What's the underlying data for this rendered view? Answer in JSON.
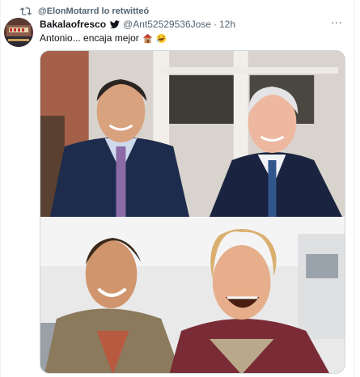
{
  "retweet": {
    "text": "@ElonMotarrd lo retwitteó"
  },
  "tweet": {
    "name": "Bakalaofresco",
    "handle": "@Ant52529536Jose",
    "separator": "·",
    "time": "12h",
    "more_label": "···",
    "text": "Antonio... encaja mejor",
    "emojis": [
      "house-emoji",
      "rofl-emoji"
    ]
  },
  "media": {
    "images": [
      "photo-politicians",
      "photo-movie-scene"
    ]
  },
  "colors": {
    "secondary": "#536471",
    "primary_text": "#0f1419",
    "twitter_blue": "#1d9bf0"
  }
}
